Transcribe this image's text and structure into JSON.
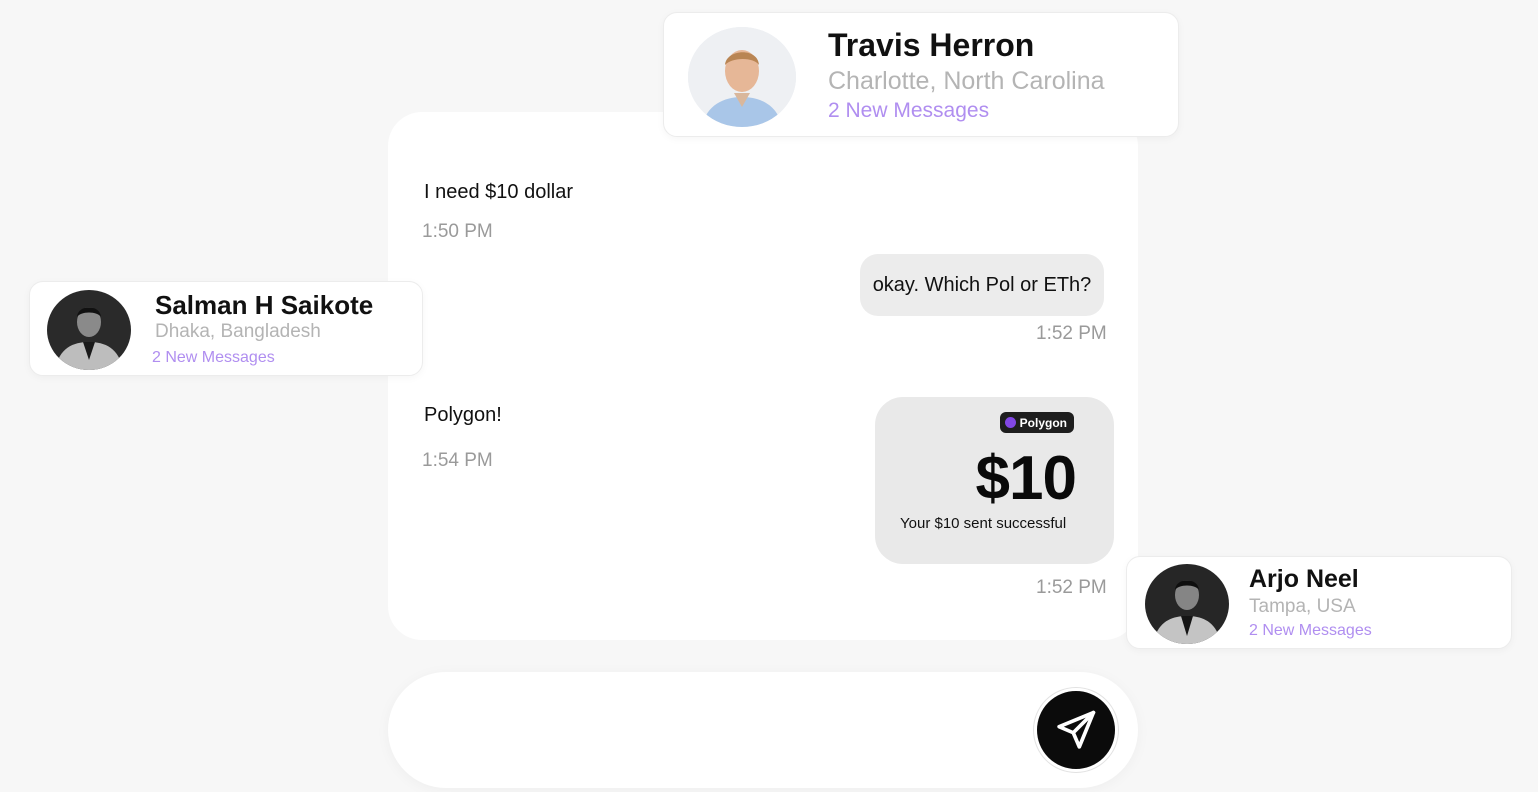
{
  "header_contact": {
    "name": "Travis Herron",
    "location": "Charlotte, North Carolina",
    "new_messages": "2 New Messages"
  },
  "left_contact": {
    "name": "Salman H Saikote",
    "location": "Dhaka, Bangladesh",
    "new_messages": "2 New Messages"
  },
  "right_contact": {
    "name": "Arjo Neel",
    "location": "Tampa, USA",
    "new_messages": "2 New Messages"
  },
  "messages": [
    {
      "direction": "incoming",
      "text": "I need $10 dollar",
      "time": "1:50 PM"
    },
    {
      "direction": "outgoing",
      "text": "okay. Which Pol or ETh?",
      "time": "1:52 PM"
    },
    {
      "direction": "incoming",
      "text": "Polygon!",
      "time": "1:54 PM"
    },
    {
      "direction": "outgoing",
      "type": "payment",
      "network": "Polygon",
      "amount": "$10",
      "caption": "Your $10 sent successful",
      "time": "1:52 PM"
    }
  ],
  "colors": {
    "accent_purple": "#b08ef0",
    "polygon": "#8247e5",
    "send_button": "#0b0b0b"
  },
  "icons": {
    "send": "send-icon",
    "network": "polygon-icon"
  }
}
